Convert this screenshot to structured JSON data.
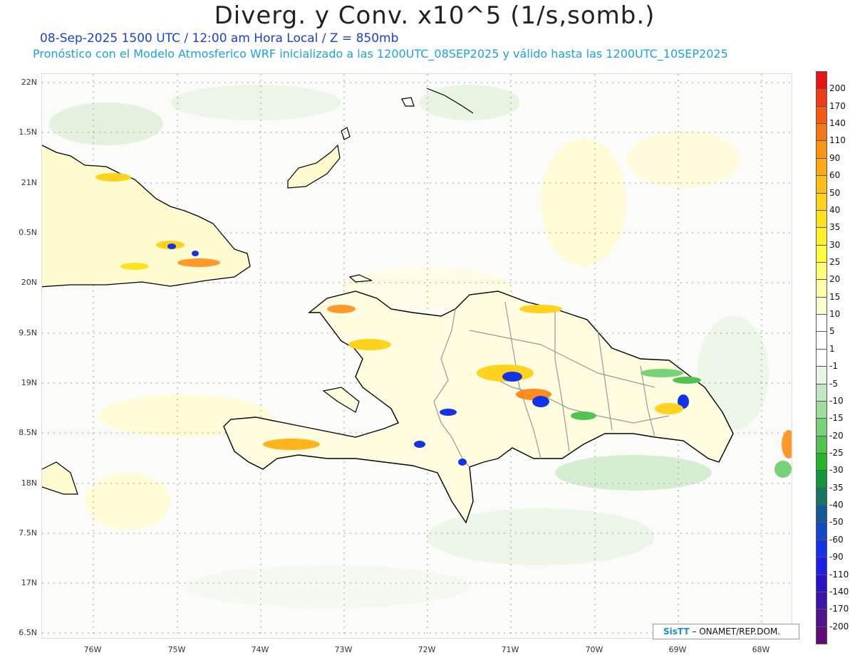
{
  "header": {
    "title": "Diverg. y Conv. x10^5 (1/s,somb.)",
    "subtitle_date": "08-Sep-2025 1500 UTC / 12:00 am Hora Local / Z = 850mb",
    "subtitle_model": "Pronóstico con el Modelo Atmosferico WRF inicializado a las 1200UTC_08SEP2025 y válido hasta las  1200UTC_10SEP2025"
  },
  "axes": {
    "lat_ticks": [
      "22N",
      "1.5N",
      "21N",
      "0.5N",
      "20N",
      "9.5N",
      "19N",
      "8.5N",
      "18N",
      "7.5N",
      "17N",
      "6.5N"
    ],
    "lon_ticks": [
      "76W",
      "75W",
      "74W",
      "73W",
      "72W",
      "71W",
      "70W",
      "69W",
      "68W"
    ]
  },
  "colorbar": {
    "labels": [
      "200",
      "170",
      "140",
      "110",
      "90",
      "60",
      "50",
      "40",
      "35",
      "30",
      "25",
      "20",
      "15",
      "10",
      "5",
      "1",
      "-1",
      "-5",
      "-10",
      "-15",
      "-20",
      "-25",
      "-30",
      "-35",
      "-40",
      "-50",
      "-60",
      "-90",
      "-110",
      "-140",
      "-170",
      "-200"
    ],
    "colors": [
      "#e61414",
      "#f03c14",
      "#f55a14",
      "#f57814",
      "#fa9614",
      "#ffaa14",
      "#ffbe14",
      "#ffd21e",
      "#ffe11e",
      "#fff028",
      "#ffff3c",
      "#ffff78",
      "#ffffaa",
      "#ffffd2",
      "#ffffff",
      "#ffffff",
      "#ffffff",
      "#e6f5e6",
      "#c3e6c3",
      "#a0dca0",
      "#78d278",
      "#50c350",
      "#28b428",
      "#14963c",
      "#147864",
      "#145a96",
      "#1446c8",
      "#1432e6",
      "#1e1ee6",
      "#2814c8",
      "#3c14aa",
      "#50148c",
      "#640a78"
    ]
  },
  "credit": {
    "logo": "SisTT",
    "text": "– ONAMET/REP.DOM."
  }
}
